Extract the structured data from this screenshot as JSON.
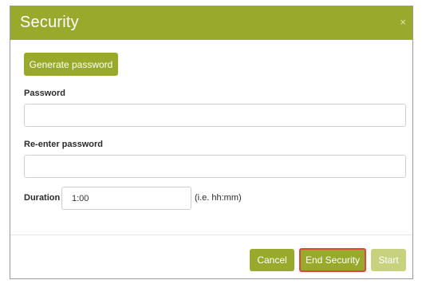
{
  "dialog": {
    "title": "Security",
    "close_label": "×"
  },
  "buttons": {
    "generate_password": "Generate password",
    "cancel": "Cancel",
    "end_security": "End Security",
    "start": "Start"
  },
  "fields": {
    "password": {
      "label": "Password",
      "value": ""
    },
    "reenter_password": {
      "label": "Re-enter password",
      "value": ""
    },
    "duration": {
      "label": "Duration",
      "value": "1:00",
      "hint": "(i.e. hh:mm)"
    }
  },
  "colors": {
    "accent": "#99a92c",
    "accent_disabled": "#c8d27e",
    "highlight_border": "#d9473d"
  }
}
